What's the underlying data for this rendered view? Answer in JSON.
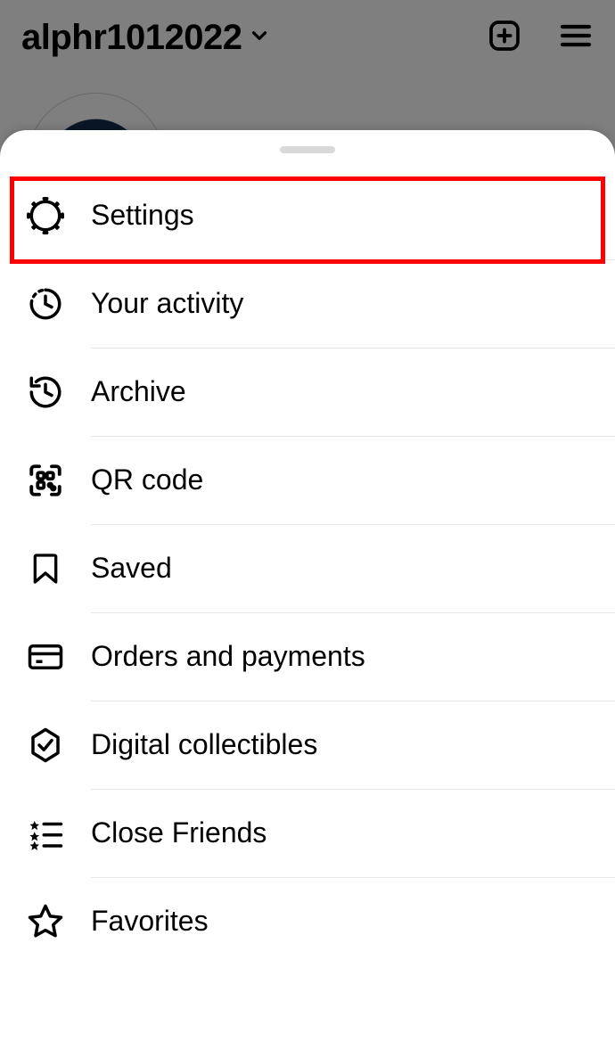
{
  "header": {
    "username": "alphr1012022"
  },
  "menu": {
    "items": [
      {
        "label": "Settings"
      },
      {
        "label": "Your activity"
      },
      {
        "label": "Archive"
      },
      {
        "label": "QR code"
      },
      {
        "label": "Saved"
      },
      {
        "label": "Orders and payments"
      },
      {
        "label": "Digital collectibles"
      },
      {
        "label": "Close Friends"
      },
      {
        "label": "Favorites"
      }
    ]
  }
}
